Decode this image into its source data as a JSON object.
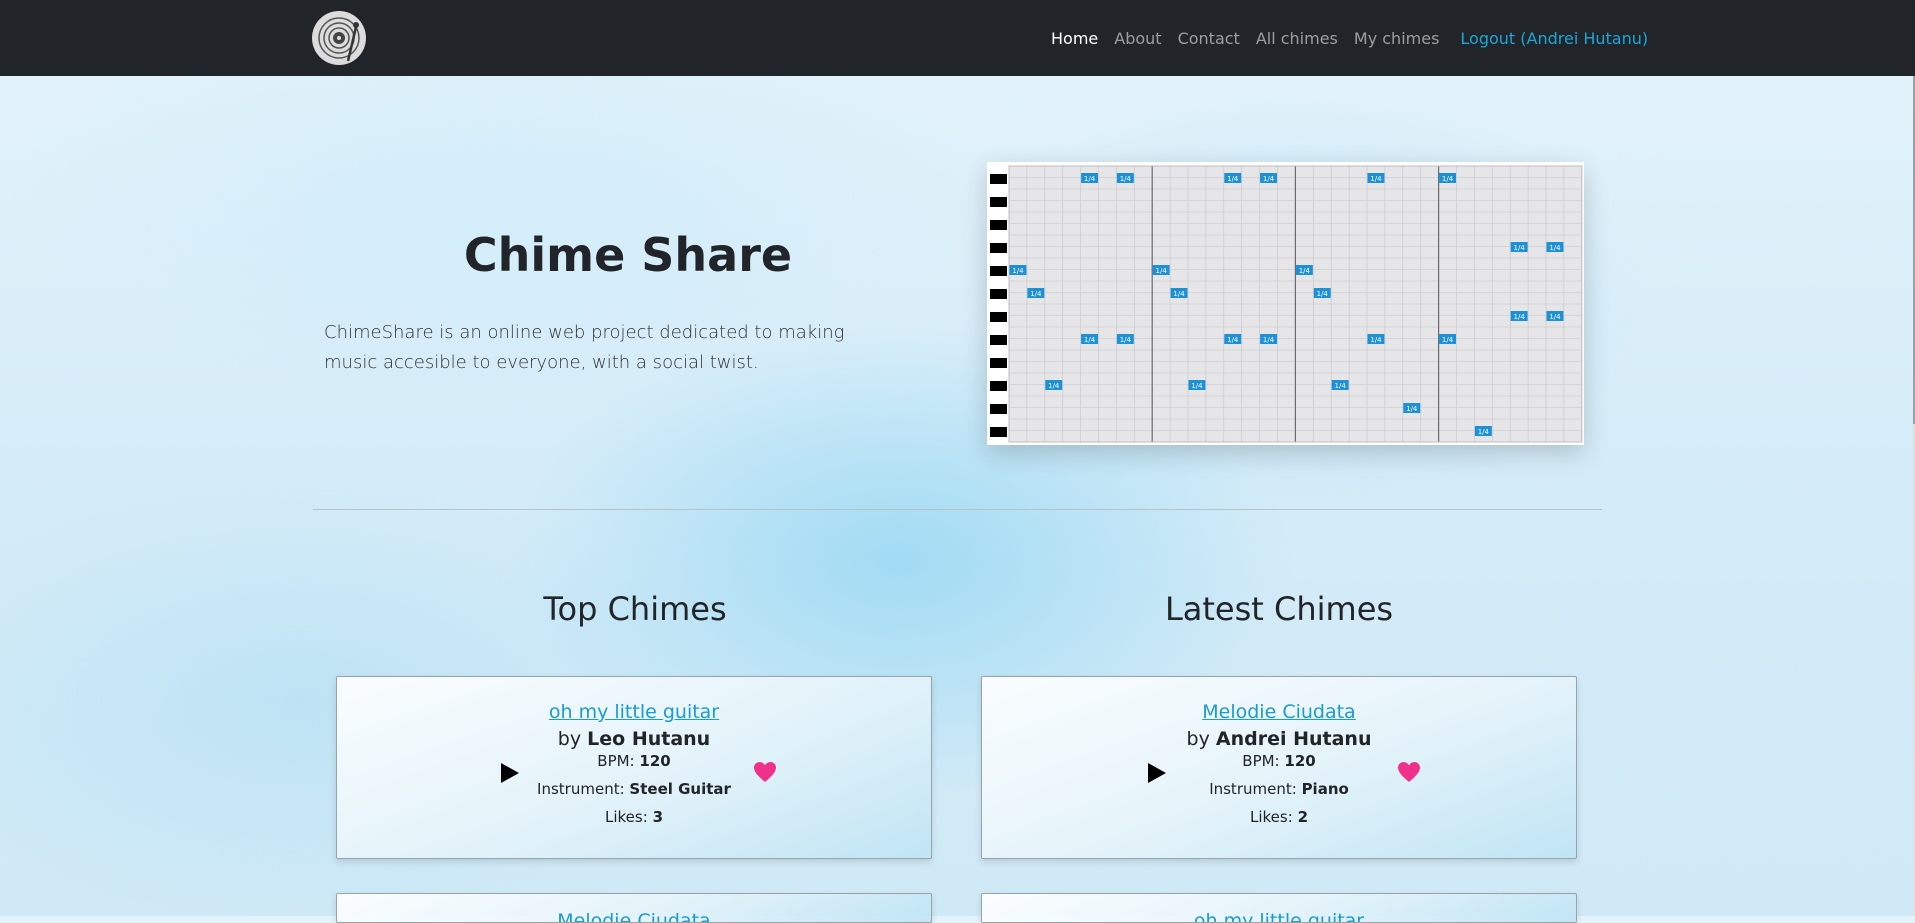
{
  "nav": {
    "logo_icon": "vinyl-record-icon",
    "links": [
      "Home",
      "About",
      "Contact",
      "All chimes",
      "My chimes"
    ],
    "active": "Home",
    "logout": "Logout (Andrei Hutanu)"
  },
  "hero": {
    "title": "Chime Share",
    "description": "ChimeShare is an online web project dedicated to making music accesible to everyone, with a social twist.",
    "roll_note_label": "1/4",
    "roll_notes": [
      {
        "row": 0,
        "step": 4
      },
      {
        "row": 0,
        "step": 6
      },
      {
        "row": 0,
        "step": 12
      },
      {
        "row": 0,
        "step": 14
      },
      {
        "row": 0,
        "step": 20
      },
      {
        "row": 0,
        "step": 24
      },
      {
        "row": 3,
        "step": 28
      },
      {
        "row": 3,
        "step": 30
      },
      {
        "row": 4,
        "step": 0
      },
      {
        "row": 4,
        "step": 8
      },
      {
        "row": 4,
        "step": 16
      },
      {
        "row": 5,
        "step": 1
      },
      {
        "row": 5,
        "step": 9
      },
      {
        "row": 5,
        "step": 17
      },
      {
        "row": 6,
        "step": 28
      },
      {
        "row": 6,
        "step": 30
      },
      {
        "row": 7,
        "step": 4
      },
      {
        "row": 7,
        "step": 6
      },
      {
        "row": 7,
        "step": 12
      },
      {
        "row": 7,
        "step": 14
      },
      {
        "row": 7,
        "step": 20
      },
      {
        "row": 7,
        "step": 24
      },
      {
        "row": 9,
        "step": 2
      },
      {
        "row": 9,
        "step": 10
      },
      {
        "row": 9,
        "step": 18
      },
      {
        "row": 10,
        "step": 22
      },
      {
        "row": 11,
        "step": 26
      }
    ]
  },
  "colors": {
    "navbar": "#212529",
    "link": "#1ea6d9",
    "note": "#1e90d6",
    "heart": "#f0318b"
  },
  "sections": {
    "top": "Top Chimes",
    "latest": "Latest Chimes"
  },
  "labels": {
    "by": "by",
    "bpm": "BPM:",
    "instrument": "Instrument:",
    "likes": "Likes:"
  },
  "top_chimes": [
    {
      "title": "oh my little guitar",
      "author": "Leo Hutanu",
      "bpm": "120",
      "instrument": "Steel Guitar",
      "likes": "3"
    },
    {
      "title": "Melodie Ciudata"
    }
  ],
  "latest_chimes": [
    {
      "title": "Melodie Ciudata",
      "author": "Andrei Hutanu",
      "bpm": "120",
      "instrument": "Piano",
      "likes": "2"
    },
    {
      "title": "oh my little guitar"
    }
  ]
}
